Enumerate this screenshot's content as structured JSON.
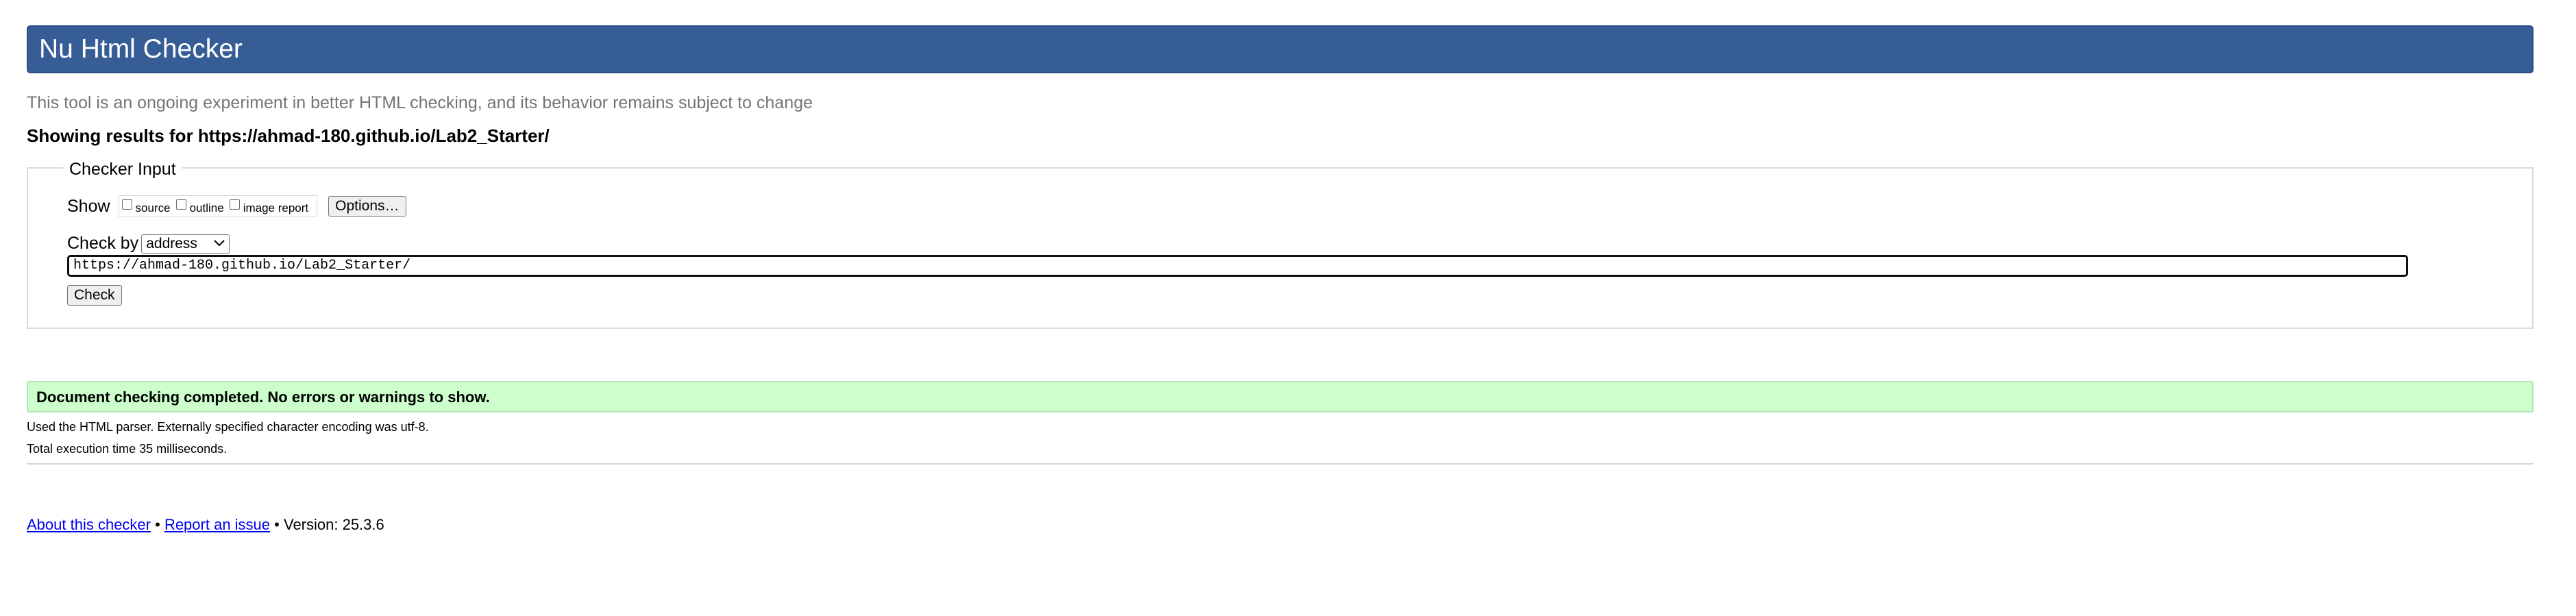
{
  "header": {
    "title": "Nu Html Checker"
  },
  "tagline": "This tool is an ongoing experiment in better HTML checking, and its behavior remains subject to change",
  "showing_results": "Showing results for https://ahmad-180.github.io/Lab2_Starter/",
  "checker_input": {
    "legend": "Checker Input",
    "show_label": "Show",
    "show_options": [
      {
        "label": "source",
        "checked": false
      },
      {
        "label": "outline",
        "checked": false
      },
      {
        "label": "image report",
        "checked": false
      }
    ],
    "options_button": "Options…",
    "check_by_label": "Check by",
    "check_by_selected": "address",
    "url_value": "https://ahmad-180.github.io/Lab2_Starter/",
    "check_button": "Check"
  },
  "result": {
    "success_message": "Document checking completed. No errors or warnings to show.",
    "parser_info": "Used the HTML parser. Externally specified character encoding was utf-8.",
    "execution_time": "Total execution time 35 milliseconds."
  },
  "footer": {
    "about_link": "About this checker",
    "separator": "•",
    "report_link": "Report an issue",
    "version": "Version: 25.3.6"
  },
  "colors": {
    "header_bg": "#365d95",
    "success_bg": "#ccffcc",
    "link": "#0000ee"
  }
}
